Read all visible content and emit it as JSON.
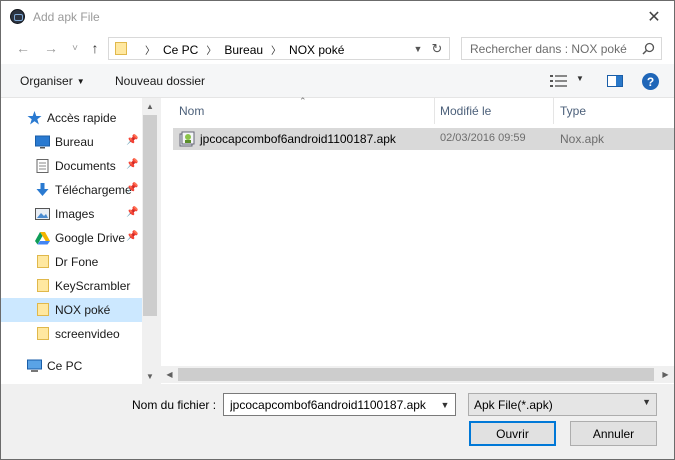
{
  "window": {
    "title": "Add apk File",
    "close_glyph": "✕"
  },
  "nav": {
    "back_glyph": "←",
    "forward_glyph": "→",
    "recent_glyph": "˅",
    "up_glyph": "↑",
    "breadcrumbs": [
      "Ce PC",
      "Bureau",
      "NOX poké"
    ],
    "search_placeholder": "Rechercher dans : NOX poké"
  },
  "toolbar": {
    "organize_label": "Organiser",
    "new_folder_label": "Nouveau dossier",
    "help_glyph": "?"
  },
  "sidebar": {
    "quick_access": "Accès rapide",
    "items": [
      {
        "label": "Bureau",
        "icon": "desktop-icon",
        "pinned": true
      },
      {
        "label": "Documents",
        "icon": "documents-icon",
        "pinned": true
      },
      {
        "label": "Téléchargeme",
        "icon": "download-icon",
        "pinned": true
      },
      {
        "label": "Images",
        "icon": "images-icon",
        "pinned": true
      },
      {
        "label": "Google Drive",
        "icon": "google-drive-icon",
        "pinned": true
      },
      {
        "label": "Dr Fone",
        "icon": "folder-icon",
        "pinned": false
      },
      {
        "label": "KeyScrambler",
        "icon": "folder-icon",
        "pinned": false
      },
      {
        "label": "NOX poké",
        "icon": "folder-icon",
        "pinned": false,
        "selected": true
      },
      {
        "label": "screenvideo",
        "icon": "folder-icon",
        "pinned": false
      }
    ],
    "this_pc": "Ce PC"
  },
  "file_list": {
    "columns": {
      "name": "Nom",
      "modified": "Modifié le",
      "type": "Type"
    },
    "rows": [
      {
        "name": "jpcocapcombof6android1100187.apk",
        "modified": "02/03/2016 09:59",
        "type": "Nox.apk"
      }
    ]
  },
  "footer": {
    "filename_label": "Nom du fichier :",
    "filename_value": "jpcocapcombof6android1100187.apk",
    "filetype_value": "Apk File(*.apk)",
    "open_label": "Ouvrir",
    "cancel_label": "Annuler"
  },
  "colors": {
    "selection": "#cce8ff",
    "row_highlight": "#d9d9d9",
    "accent": "#0078d7"
  }
}
